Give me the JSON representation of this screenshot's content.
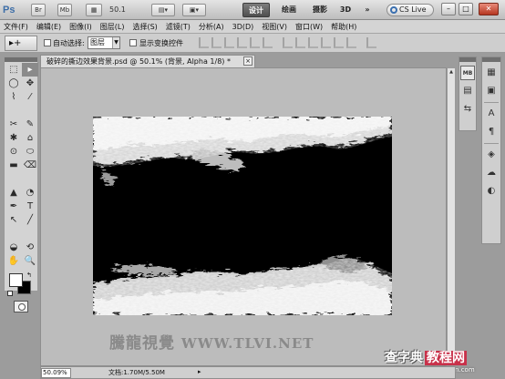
{
  "app": {
    "logo": "Ps",
    "bridge_label": "Br",
    "minibridge_label": "Mb",
    "zoom_value": "50.1",
    "workspaces": [
      "设计",
      "绘画",
      "摄影",
      "3D"
    ],
    "more": "»",
    "cslive": "CS Live",
    "window_buttons": [
      "–",
      "□",
      "✕"
    ]
  },
  "menu": [
    "文件(F)",
    "编辑(E)",
    "图像(I)",
    "图层(L)",
    "选择(S)",
    "滤镜(T)",
    "分析(A)",
    "3D(D)",
    "视图(V)",
    "窗口(W)",
    "帮助(H)"
  ],
  "options": {
    "tool_preset": "▸+",
    "auto_select_label": "自动选择:",
    "auto_select_value": "图层",
    "show_transform_label": "显示变换控件"
  },
  "tools": [
    "⬚",
    "▸",
    "◯",
    "✥",
    "⌇",
    "⁄",
    "✂",
    "✎",
    "✱",
    "⌂",
    "⊙",
    "⬭",
    "▬",
    "⌫",
    "▲",
    "◔",
    "✒",
    "T",
    "↖",
    "╱",
    "◒",
    "⟲",
    "✋",
    "🔍"
  ],
  "document": {
    "tab_title": "破碎的撕边效果背景.psd @ 50.1% (背景, Alpha 1/8) *",
    "close": "×"
  },
  "status": {
    "zoom": "50.09%",
    "doc_size": "文档:1.70M/5.50M",
    "arrow": "▸"
  },
  "watermarks": {
    "main_cn": "騰龍視覺",
    "main_url": "WWW.TLVI.NET",
    "corner_title": "查字典",
    "corner_box": "教程网",
    "corner_url": "jiaocheng.chazidian.com"
  },
  "docks": {
    "dock1": [
      "MB",
      "▤",
      "⇆"
    ],
    "dock2": [
      "▦",
      "▣",
      "A",
      "¶",
      "◈",
      "☁",
      "◐"
    ]
  }
}
